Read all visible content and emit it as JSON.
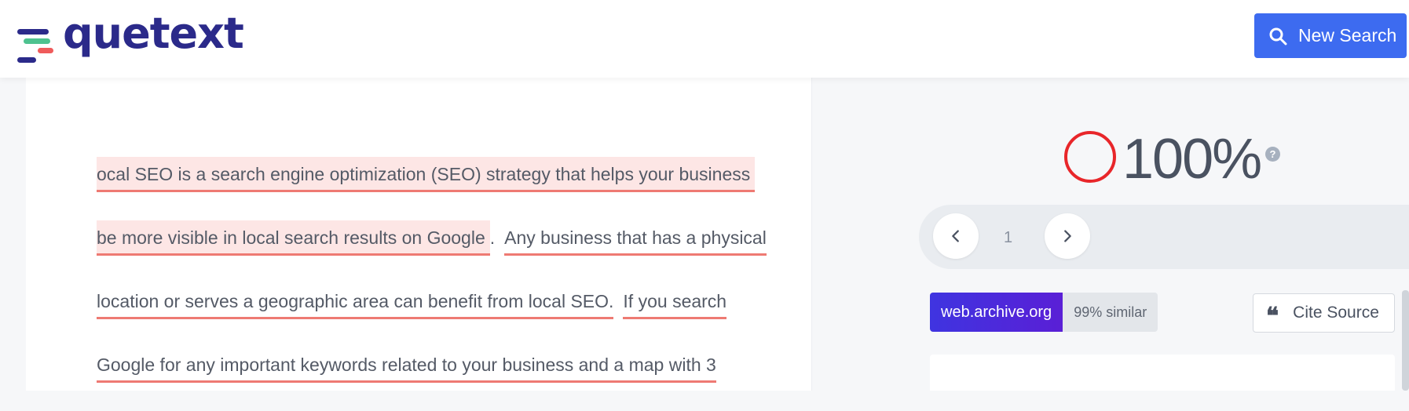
{
  "header": {
    "logo_text": "quetext",
    "new_search_label": "New Search"
  },
  "document": {
    "lines": [
      [
        {
          "text": "ocal SEO is a search engine optimization (SEO) strategy that helps your business",
          "highlight": true
        }
      ],
      [
        {
          "text": "be more visible in local search results on Google",
          "highlight": true
        },
        {
          "text": ".",
          "plain": true
        },
        {
          "text": "Any business that has a physical",
          "highlight": false
        }
      ],
      [
        {
          "text": "location or serves a geographic area can benefit from local SEO.",
          "highlight": false
        },
        {
          "text": "If you search",
          "highlight": false
        }
      ],
      [
        {
          "text": "Google for any important keywords related to your business and a map with 3",
          "highlight": false
        }
      ]
    ]
  },
  "score": {
    "value": "100%",
    "help_icon": "?",
    "ring_color": "#e8262a"
  },
  "pager": {
    "current": "1",
    "prev_icon": "chevron-left-icon",
    "next_icon": "chevron-right-icon"
  },
  "source": {
    "name": "web.archive.org",
    "similarity": "99% similar"
  },
  "cite": {
    "icon": "quote-icon",
    "label": "Cite Source"
  },
  "colors": {
    "accent": "#3d6bf0",
    "brand": "#2b2a8a",
    "highlight_bg": "#fde6e5",
    "underline": "#ee7a73"
  }
}
